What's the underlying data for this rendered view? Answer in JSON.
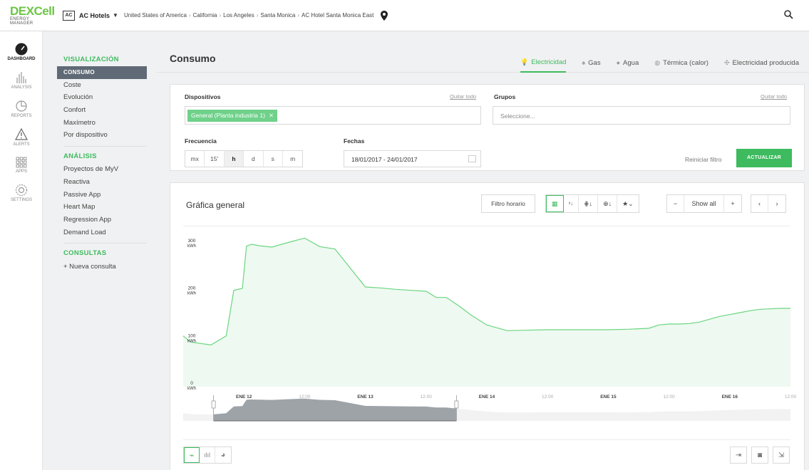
{
  "app": {
    "logo_main": "DEXCell",
    "logo_sub": "ENERGY MANAGER"
  },
  "topbar": {
    "client_badge": "AC",
    "client_name": "AC Hotels",
    "breadcrumb": [
      "United States of America",
      "California",
      "Los Angeles",
      "Santa Monica",
      "AC Hotel Santa Monica East"
    ]
  },
  "rail": [
    {
      "label": "DASHBOARD",
      "icon": "gauge-icon"
    },
    {
      "label": "ANALYSIS",
      "icon": "bars-icon"
    },
    {
      "label": "REPORTS",
      "icon": "pie-icon"
    },
    {
      "label": "ALERTS",
      "icon": "warning-icon"
    },
    {
      "label": "APPS",
      "icon": "grid-icon"
    },
    {
      "label": "SETTINGS",
      "icon": "gear-icon"
    }
  ],
  "subnav": {
    "visual_title": "VISUALIZACIÓN",
    "visual_items": [
      "CONSUMO",
      "Coste",
      "Evolución",
      "Confort",
      "Maxímetro",
      "Por dispositivo"
    ],
    "analysis_title": "ANÁLISIS",
    "analysis_items": [
      "Proyectos de MyV",
      "Reactiva",
      "Passive App",
      "Heart Map",
      "Regression App",
      "Demand Load"
    ],
    "queries_title": "CONSULTAS",
    "new_query": "+ Nueva consulta"
  },
  "page": {
    "title": "Consumo",
    "tabs": [
      {
        "label": "Electricidad",
        "active": true
      },
      {
        "label": "Gas"
      },
      {
        "label": "Agua"
      },
      {
        "label": "Térmica (calor)"
      },
      {
        "label": "Electricidad producida"
      }
    ]
  },
  "filters": {
    "devices_label": "Dispositivos",
    "devices_clear": "Quitar todo",
    "device_tag": "General (Planta industria 1)",
    "groups_label": "Grupos",
    "groups_clear": "Quitar todo",
    "groups_placeholder": "Seleccione...",
    "frequency_label": "Frecuencia",
    "frequency_options": [
      "mx",
      "15'",
      "h",
      "d",
      "s",
      "m"
    ],
    "frequency_selected": "h",
    "dates_label": "Fechas",
    "dates_value": "18/01/2017 - 24/01/2017",
    "reset_label": "Reiniciar filtro",
    "update_label": "ACTUALIZAR"
  },
  "chart_panel": {
    "title": "Gráfica general",
    "time_filter": "Filtro horario",
    "show_all": "Show all",
    "minus": "−",
    "plus": "+",
    "prev": "‹",
    "next": "›"
  },
  "colors": {
    "accent": "#3dbb5e",
    "line": "#6ad67f",
    "fill": "#eef9f1"
  },
  "chart_data": {
    "type": "area",
    "unit": "kWh",
    "y_ticks": [
      {
        "value": 0,
        "label": "0",
        "unit": "kWh"
      },
      {
        "value": 100,
        "label": "100",
        "unit": "kWh"
      },
      {
        "value": 200,
        "label": "200",
        "unit": "kWh"
      },
      {
        "value": 300,
        "label": "300",
        "unit": "kWh"
      }
    ],
    "ylim": [
      0,
      300
    ],
    "xlim": [
      0,
      120
    ],
    "x_ticks": [
      {
        "x": 12,
        "label": "ENE 12",
        "bold": true
      },
      {
        "x": 24,
        "label": "12:00",
        "bold": false
      },
      {
        "x": 36,
        "label": "ENE 13",
        "bold": true
      },
      {
        "x": 48,
        "label": "12:00",
        "bold": false
      },
      {
        "x": 60,
        "label": "ENE 14",
        "bold": true
      },
      {
        "x": 72,
        "label": "12:00",
        "bold": false
      },
      {
        "x": 84,
        "label": "ENE 15",
        "bold": true
      },
      {
        "x": 96,
        "label": "12:00",
        "bold": false
      },
      {
        "x": 108,
        "label": "ENE 16",
        "bold": true
      },
      {
        "x": 120,
        "label": "12:00",
        "bold": false
      }
    ],
    "x": [
      0,
      1.5,
      5.5,
      8.5,
      10,
      11.7,
      12.5,
      13.5,
      15,
      17.5,
      21.5,
      24,
      27,
      30,
      33,
      36,
      39,
      42,
      45,
      48,
      50,
      52,
      54.5,
      57,
      60,
      62,
      64,
      68,
      72,
      76,
      80,
      84,
      88,
      92,
      94,
      96,
      98,
      100,
      102,
      104,
      106,
      108,
      110,
      112,
      114,
      116,
      118,
      120
    ],
    "y": [
      107,
      94,
      88,
      107,
      203,
      207,
      296,
      300,
      297,
      294,
      306,
      313,
      295,
      290,
      250,
      210,
      208,
      205,
      203,
      201,
      188,
      188,
      170,
      150,
      130,
      124,
      118,
      119,
      120,
      120,
      120,
      120,
      121,
      123,
      130,
      132,
      132,
      133,
      136,
      142,
      148,
      152,
      156,
      160,
      163,
      164,
      165,
      165
    ]
  },
  "navigator": {
    "handle_left": 6,
    "handle_right": 54
  }
}
